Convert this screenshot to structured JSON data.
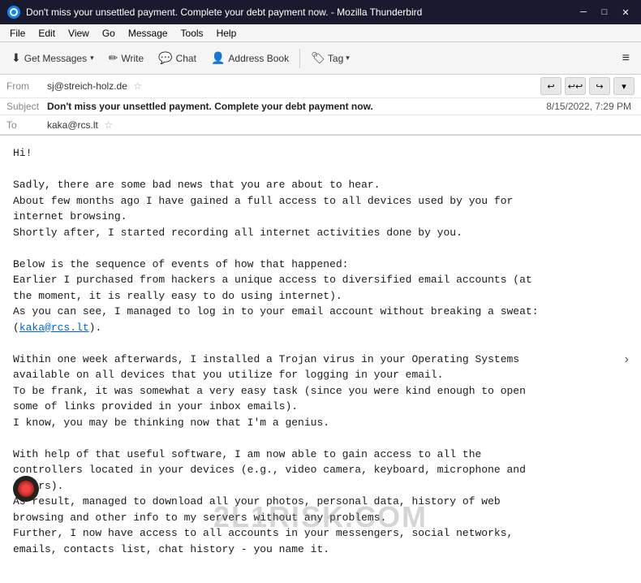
{
  "window": {
    "title": "Don't miss your unsettled payment. Complete your debt payment now. - Mozilla Thunderbird",
    "icon": "thunderbird"
  },
  "menubar": {
    "items": [
      "File",
      "Edit",
      "View",
      "Go",
      "Message",
      "Tools",
      "Help"
    ]
  },
  "toolbar": {
    "get_messages_label": "Get Messages",
    "write_label": "Write",
    "chat_label": "Chat",
    "address_book_label": "Address Book",
    "tag_label": "Tag",
    "hamburger": "≡"
  },
  "email": {
    "from_label": "From",
    "from_value": "sj@streich-holz.de",
    "subject_label": "Subject",
    "subject_value": "Don't miss your unsettled payment. Complete your debt payment now.",
    "date_value": "8/15/2022, 7:29 PM",
    "to_label": "To",
    "to_value": "kaka@rcs.lt",
    "body": "Hi!\n\nSadly, there are some bad news that you are about to hear.\nAbout few months ago I have gained a full access to all devices used by you for\ninternet browsing.\nShortly after, I started recording all internet activities done by you.\n\nBelow is the sequence of events of how that happened:\nEarlier I purchased from hackers a unique access to diversified email accounts (at\nthe moment, it is really easy to do using internet).\nAs you can see, I managed to log in to your email account without breaking a sweat:\n(kaka@rcs.lt).\n\nWithin one week afterwards, I installed a Trojan virus in your Operating Systems\navailable on all devices that you utilize for logging in your email.\nTo be frank, it was somewhat a very easy task (since you were kind enough to open\nsome of links provided in your inbox emails).\nI know, you may be thinking now that I'm a genius.\n\nWith help of that useful software, I am now able to gain access to all the\ncontrollers located in your devices (e.g., video camera, keyboard, microphone and\nothers).\nAs result, managed to download all your photos, personal data, history of web\nbrowsing and other info to my servers without any problems.\nFurther, I now have access to all accounts in your messengers, social networks,\nemails, contacts list, chat history - you name it.",
    "link_text": "kaka@rcs.lt"
  },
  "watermark": {
    "text": "2L1RISK.COM"
  },
  "scrollbar": {
    "up_arrow": "▲",
    "down_arrow": "▼"
  }
}
